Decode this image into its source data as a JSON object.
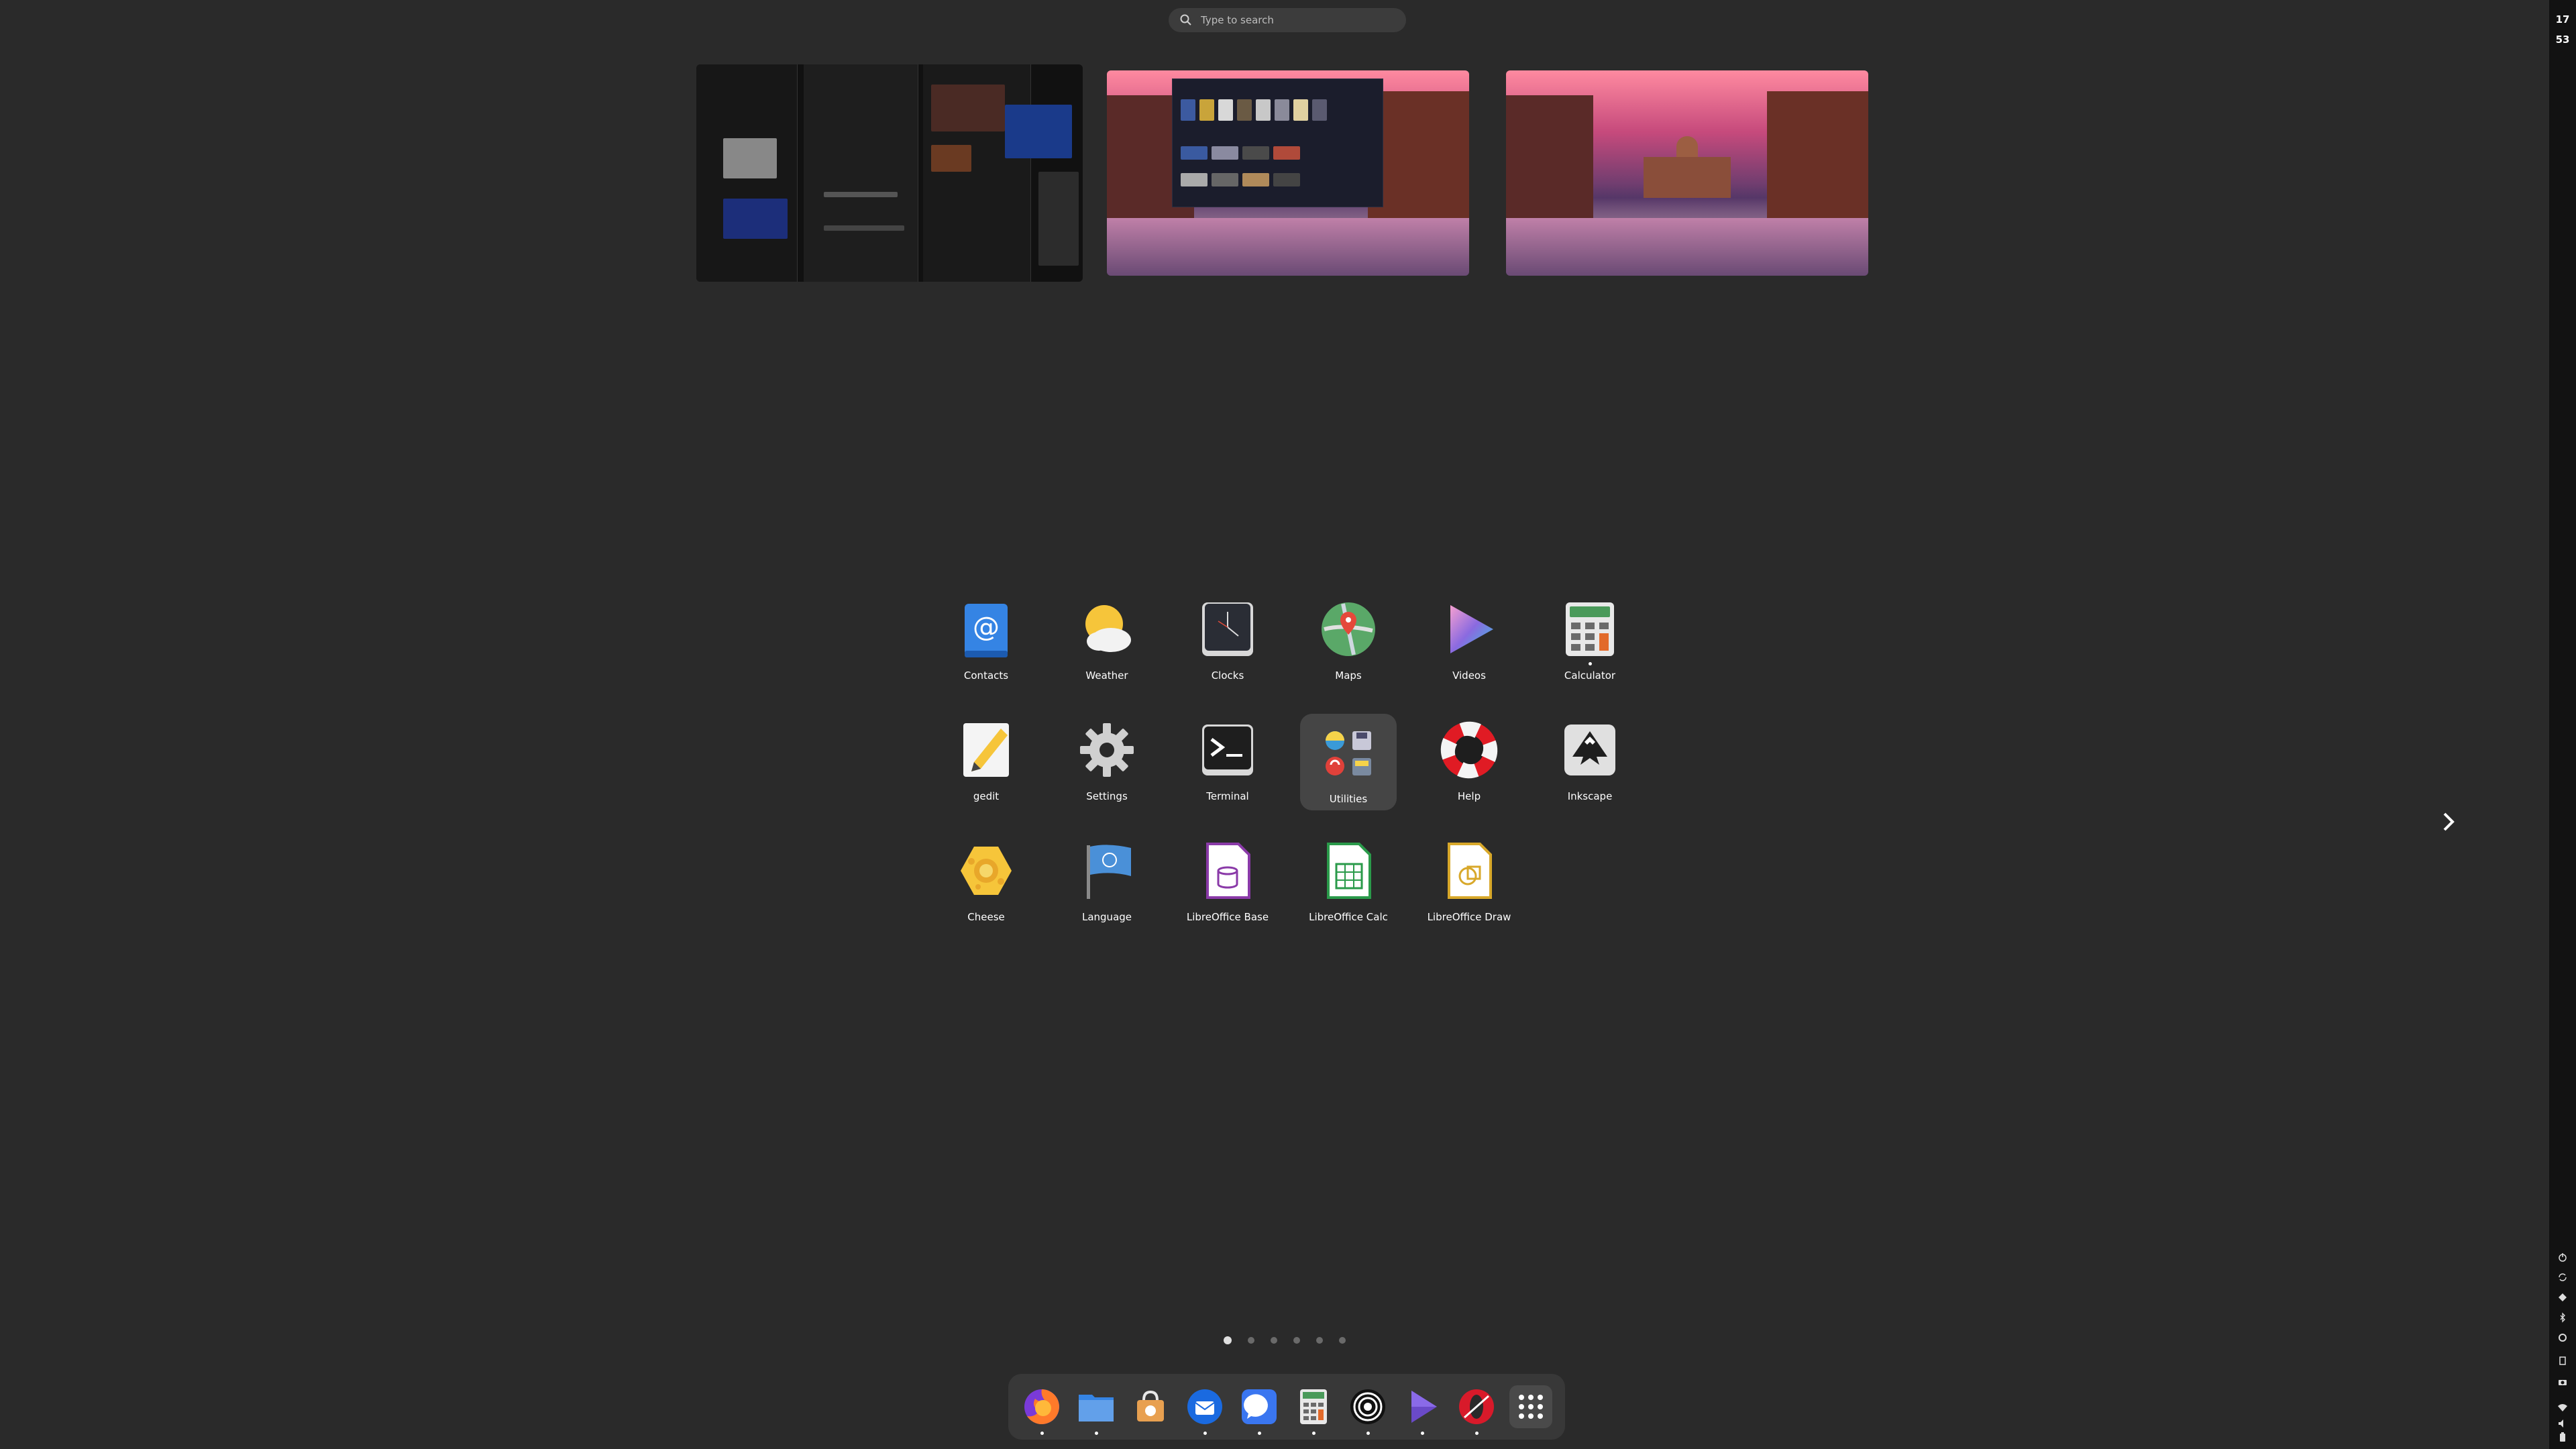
{
  "search": {
    "placeholder": "Type to search"
  },
  "clock": {
    "hour": "17",
    "minute": "53"
  },
  "apps": [
    {
      "label": "Contacts",
      "icon": "contacts-icon"
    },
    {
      "label": "Weather",
      "icon": "weather-icon"
    },
    {
      "label": "Clocks",
      "icon": "clocks-icon"
    },
    {
      "label": "Maps",
      "icon": "maps-icon"
    },
    {
      "label": "Videos",
      "icon": "videos-icon"
    },
    {
      "label": "Calculator",
      "icon": "calculator-icon",
      "running": true
    },
    {
      "label": "gedit",
      "icon": "gedit-icon"
    },
    {
      "label": "Settings",
      "icon": "settings-icon"
    },
    {
      "label": "Terminal",
      "icon": "terminal-icon"
    },
    {
      "label": "Utilities",
      "icon": "utilities-folder-icon",
      "selected": true
    },
    {
      "label": "Help",
      "icon": "help-icon"
    },
    {
      "label": "Inkscape",
      "icon": "inkscape-icon"
    },
    {
      "label": "Cheese",
      "icon": "cheese-icon"
    },
    {
      "label": "Language",
      "icon": "language-icon"
    },
    {
      "label": "LibreOffice Base",
      "icon": "libreoffice-base-icon"
    },
    {
      "label": "LibreOffice Calc",
      "icon": "libreoffice-calc-icon"
    },
    {
      "label": "LibreOffice Draw",
      "icon": "libreoffice-draw-icon"
    }
  ],
  "pager": {
    "pages": 6,
    "active": 0
  },
  "dock": [
    {
      "icon": "firefox-icon",
      "running": true
    },
    {
      "icon": "files-icon",
      "running": true
    },
    {
      "icon": "software-icon",
      "running": false
    },
    {
      "icon": "thunderbird-icon",
      "running": true
    },
    {
      "icon": "chat-icon",
      "running": true
    },
    {
      "icon": "calculator-icon",
      "running": true
    },
    {
      "icon": "tor-icon",
      "running": true
    },
    {
      "icon": "video-player-icon",
      "running": true
    },
    {
      "icon": "opera-icon",
      "running": true
    },
    {
      "icon": "show-apps-icon",
      "running": false
    }
  ],
  "colors": {
    "background": "#2a2a2a",
    "dock": "#383838",
    "accent": "#3584e4"
  }
}
